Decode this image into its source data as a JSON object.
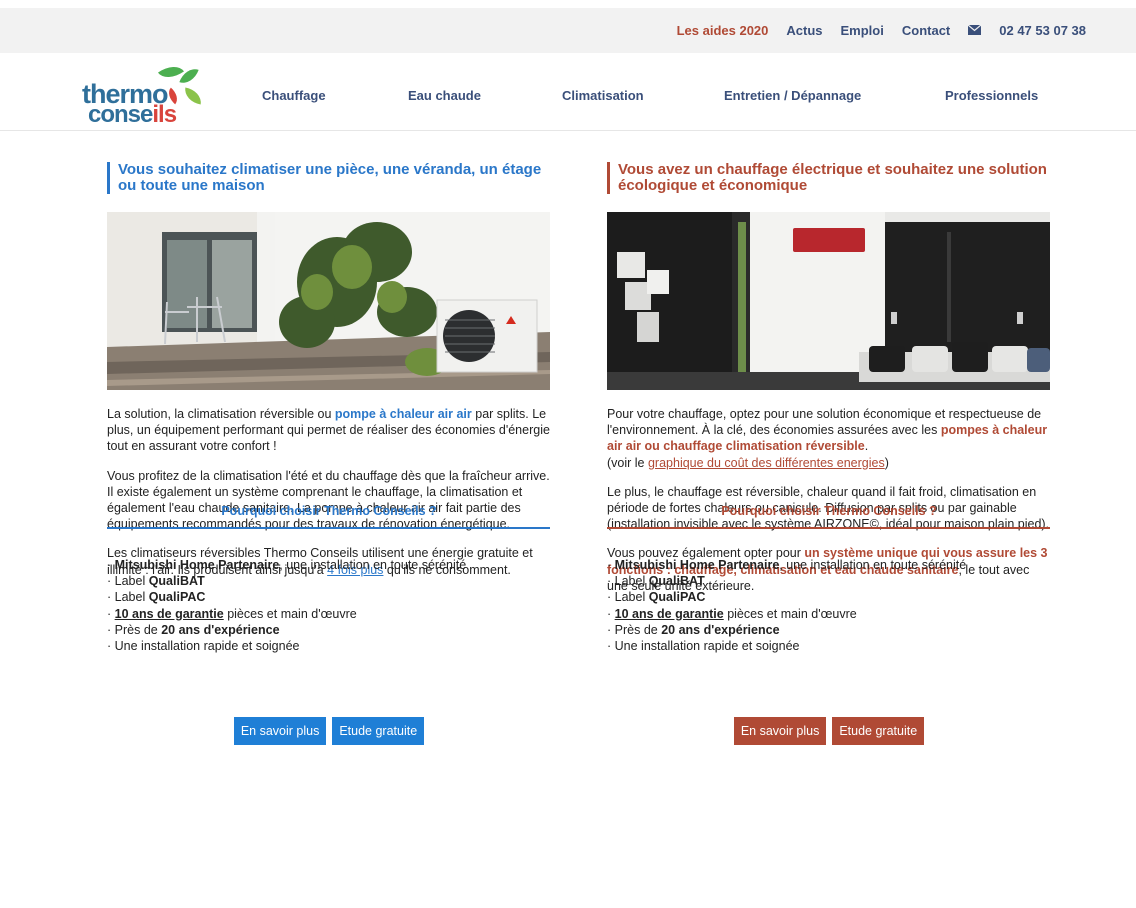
{
  "topnav": {
    "aides": "Les aides 2020",
    "actus": "Actus",
    "emploi": "Emploi",
    "contact": "Contact",
    "phone": "02 47 53 07 38"
  },
  "logo": {
    "line1": "thermo",
    "line2_a": "conse",
    "line2_b": "ils"
  },
  "mainnav": [
    "Chauffage",
    "Eau chaude",
    "Climatisation",
    "Entretien / Dépannage",
    "Professionnels"
  ],
  "left": {
    "heading": "Vous souhaitez climatiser une pièce, une véranda, un étage ou toute une maison",
    "p1_a": "La solution, la climatisation réversible ou ",
    "p1_hl": "pompe à chaleur air air",
    "p1_b": " par splits. Le plus, un équipement performant qui permet de réaliser des économies d'énergie tout en assurant votre confort !",
    "p2": "Vous profitez de la climatisation l'été et du chauffage dès que la fraîcheur arrive. Il existe également un système comprenant le chauffage, la climatisation et également l'eau chaude sanitaire. La pompe à chaleur air air fait partie des équipements recommandés pour des travaux de rénovation énergétique.",
    "p3_a": "Les climatiseurs réversibles Thermo Conseils utilisent une énergie gratuite et illimité : l'air. Ils produisent ainsi jusqu'à ",
    "p3_link": "4 fois plus",
    "p3_b": " qu'ils ne consomment.",
    "why": "Pourquoi choisir Thermo Conseils ?",
    "btn_more": "En savoir plus",
    "btn_study": "Etude gratuite"
  },
  "right": {
    "heading": "Vous avez un chauffage électrique et souhaitez une solution écologique et économique",
    "p1_a": "Pour votre chauffage, optez pour une solution économique et respectueuse de l'environnement. À la clé, des économies assurées avec les ",
    "p1_hl": "pompes à chaleur air air ou chauffage climatisation réversible",
    "p1_b": ".",
    "p1_c": "(voir le ",
    "p1_link": "graphique du coût des différentes energies",
    "p1_d": ")",
    "p2": "Le plus, le chauffage est réversible, chaleur quand il fait froid, climatisation en période de fortes chaleurs ou canicule. Diffusion par splits ou par gainable (installation invisible avec le système AIRZONE©, idéal pour maison plain pied).",
    "p3_a": "Vous pouvez également opter pour ",
    "p3_hl": "un système unique qui vous assure les 3 fonctions : chauffage, climatisation et eau chaude sanitaire",
    "p3_b": ", le tout avec une seule unité extérieure.",
    "why": "Pourquoi choisir Thermo Conseils ?",
    "btn_more": "En savoir plus",
    "btn_study": "Etude gratuite"
  },
  "bullets": {
    "b1_bold": "Mitsubishi Home Partenaire",
    "b1_rest": ", une installation en toute sérénité",
    "b2_a": "Label ",
    "b2_bold": "QualiBAT",
    "b3_a": "Label ",
    "b3_bold": "QualiPAC",
    "b4_u": "10 ans de garantie",
    "b4_rest": " pièces et main d'œuvre",
    "b5_a": "Près de ",
    "b5_bold": "20 ans d'expérience",
    "b6": "Une installation rapide et soignée"
  }
}
